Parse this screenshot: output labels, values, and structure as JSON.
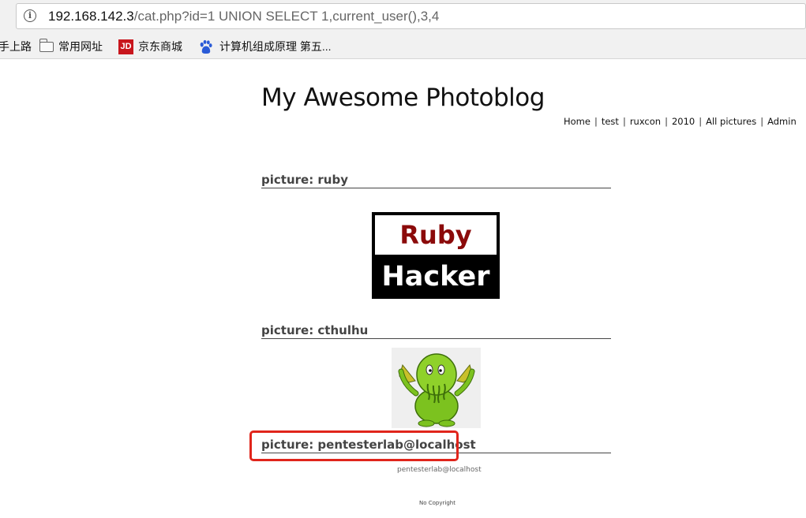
{
  "browser": {
    "url_host": "192.168.142.3",
    "url_path": "/cat.php?id=1 UNION SELECT 1,current_user(),3,4",
    "bookmarks": [
      {
        "label": "手上路",
        "icon": "none"
      },
      {
        "label": "常用网址",
        "icon": "folder-icon"
      },
      {
        "label": "京东商城",
        "icon": "jd-icon",
        "icon_text": "JD"
      },
      {
        "label": "计算机组成原理 第五...",
        "icon": "baidu-paw-icon"
      }
    ]
  },
  "site": {
    "title": "My Awesome Photoblog",
    "nav": [
      "Home",
      "test",
      "ruxcon",
      "2010",
      "All pictures",
      "Admin"
    ],
    "nav_separator": "|"
  },
  "pictures": [
    {
      "heading": "picture: ruby",
      "image": "ruby-hacker-logo",
      "logo_text_top": "Ruby",
      "logo_text_bottom": "Hacker"
    },
    {
      "heading": "picture: cthulhu",
      "image": "cthulhu-cartoon"
    },
    {
      "heading": "picture: pentesterlab@localhost",
      "caption": "pentesterlab@localhost"
    }
  ],
  "footer": "No Copyright",
  "colors": {
    "highlight": "#e0251b",
    "ruby_red": "#8b0a0a",
    "cthulhu_green": "#7cc21f"
  }
}
